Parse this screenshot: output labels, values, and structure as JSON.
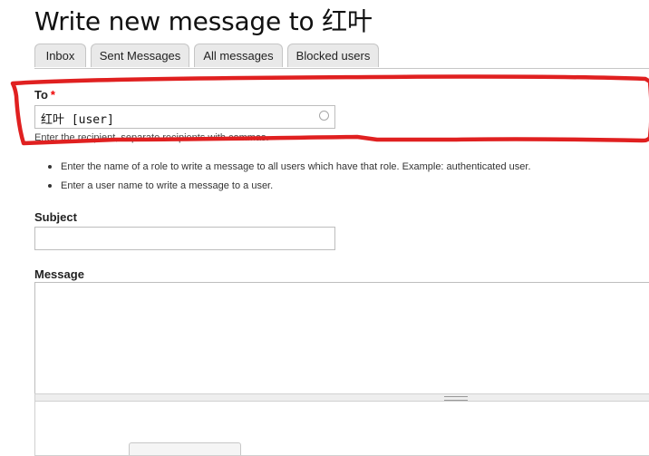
{
  "page": {
    "title": "Write new message to 红叶"
  },
  "tabs": [
    {
      "label": "Inbox"
    },
    {
      "label": "Sent Messages"
    },
    {
      "label": "All messages"
    },
    {
      "label": "Blocked users"
    }
  ],
  "form": {
    "to": {
      "label": "To",
      "required_mark": "*",
      "value": "红叶 [user]",
      "description": "Enter the recipient, separate recipients with commas."
    },
    "help_items": [
      "Enter the name of a role to write a message to all users which have that role. Example: authenticated user.",
      "Enter a user name to write a message to a user."
    ],
    "subject": {
      "label": "Subject",
      "value": ""
    },
    "message": {
      "label": "Message",
      "value": ""
    }
  },
  "annotation": {
    "color": "#e02020"
  },
  "icons": {
    "autocomplete": "autocomplete-throbber-icon",
    "resize": "resize-grip-icon"
  }
}
